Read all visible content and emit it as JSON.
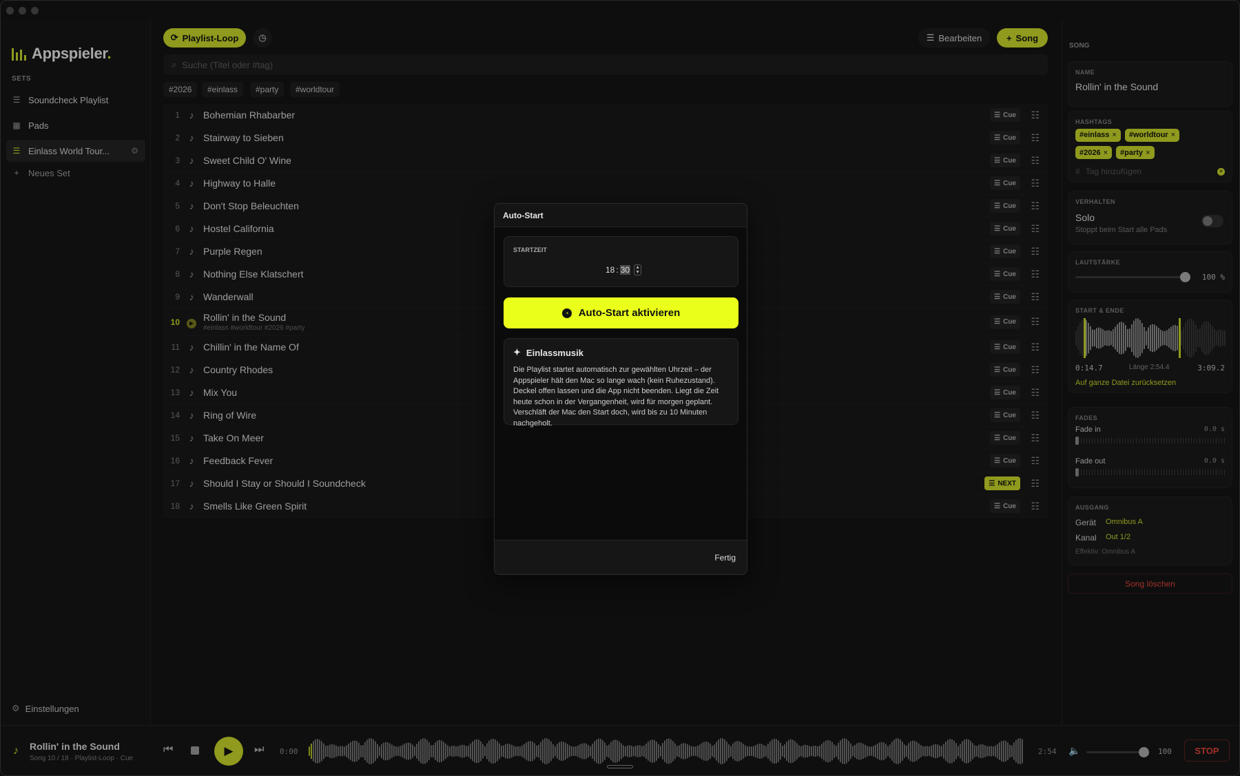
{
  "app": {
    "name": "Appspieler",
    "name_dot": "."
  },
  "sidebar": {
    "section_label": "SETS",
    "items": [
      {
        "label": "Soundcheck Playlist",
        "icon": "list-icon"
      },
      {
        "label": "Pads",
        "icon": "grid-icon"
      },
      {
        "label": "Einlass World Tour...",
        "icon": "list-icon",
        "active": true
      },
      {
        "label": "Neues Set",
        "icon": "plus-icon"
      }
    ],
    "settings_label": "Einstellungen"
  },
  "toolbar": {
    "loop_label": "Playlist-Loop",
    "edit_label": "Bearbeiten",
    "add_song_label": "Song",
    "search_placeholder": "Suche (Titel oder #tag)"
  },
  "tag_filters": [
    "#2026",
    "#einlass",
    "#party",
    "#worldtour"
  ],
  "songs": [
    {
      "num": "1",
      "title": "Bohemian Rhabarber",
      "cue": "Cue"
    },
    {
      "num": "2",
      "title": "Stairway to Sieben",
      "cue": "Cue"
    },
    {
      "num": "3",
      "title": "Sweet Child O' Wine",
      "cue": "Cue"
    },
    {
      "num": "4",
      "title": "Highway to Halle",
      "cue": "Cue"
    },
    {
      "num": "5",
      "title": "Don't Stop Beleuchten",
      "cue": "Cue"
    },
    {
      "num": "6",
      "title": "Hostel California",
      "cue": "Cue"
    },
    {
      "num": "7",
      "title": "Purple Regen",
      "cue": "Cue"
    },
    {
      "num": "8",
      "title": "Nothing Else Klatschert",
      "cue": "Cue"
    },
    {
      "num": "9",
      "title": "Wanderwall",
      "cue": "Cue"
    },
    {
      "num": "10",
      "title": "Rollin' in the Sound",
      "sub": "#einlass #worldtour #2026 #party",
      "cue": "Cue",
      "playing": true
    },
    {
      "num": "11",
      "title": "Chillin' in the Name Of",
      "cue": "Cue"
    },
    {
      "num": "12",
      "title": "Country Rhodes",
      "cue": "Cue"
    },
    {
      "num": "13",
      "title": "Mix You",
      "cue": "Cue"
    },
    {
      "num": "14",
      "title": "Ring of Wire",
      "cue": "Cue"
    },
    {
      "num": "15",
      "title": "Take On Meer",
      "cue": "Cue"
    },
    {
      "num": "16",
      "title": "Feedback Fever",
      "cue": "Cue"
    },
    {
      "num": "17",
      "title": "Should I Stay or Should I Soundcheck",
      "cue": "NEXT",
      "next": true
    },
    {
      "num": "18",
      "title": "Smells Like Green Spirit",
      "cue": "Cue"
    }
  ],
  "inspector": {
    "section_title": "SONG",
    "name_label": "NAME",
    "name_value": "Rollin' in the Sound",
    "hashtags_label": "HASHTAGS",
    "hashtags": [
      "#einlass",
      "#worldtour",
      "#2026",
      "#party"
    ],
    "tag_placeholder": "Tag hinzufügen",
    "behavior_label": "VERHALTEN",
    "solo_label": "Solo",
    "solo_desc": "Stoppt beim Start alle Pads",
    "volume_label": "LAUTSTÄRKE",
    "volume_value": "100 %",
    "volume_level": 1.0,
    "range_label": "START & ENDE",
    "range_start": "0:14.7",
    "range_length": "Länge 2:54.4",
    "range_end": "3:09.2",
    "reset_link": "Auf ganze Datei zurücksetzen",
    "fades_label": "FADES",
    "fade_in_label": "Fade in",
    "fade_in_value": "0.0 s",
    "fade_out_label": "Fade out",
    "fade_out_value": "0.0 s",
    "output_label": "AUSGANG",
    "device_label": "Gerät",
    "device_value": "Omnibus A",
    "channel_label": "Kanal",
    "channel_value": "Out 1/2",
    "effective": "Effektiv: Omnibus A",
    "delete_label": "Song löschen"
  },
  "player": {
    "title": "Rollin' in the Sound",
    "sub": "Song 10 / 18 · Playlist-Loop · Cue",
    "elapsed": "0:00",
    "total": "2:54",
    "volume": "100",
    "stop_label": "STOP"
  },
  "modal": {
    "title": "Auto-Start",
    "time_label": "STARTZEIT",
    "time_hour": "18",
    "time_sep": ":",
    "time_min": "30",
    "activate_label": "Auto-Start aktivieren",
    "info_title": "Einlassmusik",
    "info_text": "Die Playlist startet automatisch zur gewählten Uhrzeit – der Appspieler hält den Mac so lange wach (kein Ruhezustand). Deckel offen lassen und die App nicht beenden. Liegt die Zeit heute schon in der Vergangenheit, wird für morgen geplant. Verschläft der Mac den Start doch, wird bis zu 10 Minuten nachgeholt.",
    "done_label": "Fertig"
  },
  "colors": {
    "accent": "#c6d62a",
    "button": "#eaff1a",
    "danger": "#e0453a"
  }
}
